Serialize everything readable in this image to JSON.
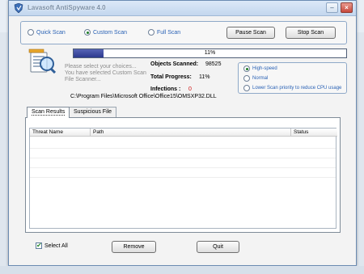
{
  "window": {
    "title": "Lavasoft AntiSpyware 4.0"
  },
  "scan_modes": {
    "options": [
      {
        "label": "Quick Scan",
        "checked": false
      },
      {
        "label": "Custom Scan",
        "checked": true
      },
      {
        "label": "Full Scan",
        "checked": false
      }
    ],
    "pause_label": "Pause Scan",
    "stop_label": "Stop Scan"
  },
  "progress": {
    "percent": 11,
    "text": "11%"
  },
  "hint": {
    "line1": "Please select your choices...",
    "line2": "You have selected Custom Scan",
    "line3": "File Scanner..."
  },
  "stats": {
    "objects_label": "Objects Scanned:",
    "objects_value": "98525",
    "total_label": "Total Progress:",
    "total_value": "11%",
    "infections_label": "Infections :",
    "infections_value": "0"
  },
  "speed": {
    "options": [
      {
        "label": "High-speed",
        "checked": true
      },
      {
        "label": "Normal",
        "checked": false
      },
      {
        "label": "Lower Scan priority to reduce CPU usage",
        "checked": false
      }
    ]
  },
  "current_path": "C:\\Program Files\\Microsoft Office\\Office15\\OMSXP32.DLL",
  "tabs": [
    {
      "label": "Scan Results",
      "active": true
    },
    {
      "label": "Suspicious File",
      "active": false
    }
  ],
  "table": {
    "columns": [
      "Threat Name",
      "Path",
      "Status"
    ],
    "rows": []
  },
  "footer": {
    "select_all_label": "Select All",
    "select_all_checked": true,
    "remove_label": "Remove",
    "quit_label": "Quit"
  },
  "colors": {
    "accent_blue": "#2a62b5",
    "progress_fill": "#2d3a8f",
    "infection_red": "#d01010",
    "check_green": "#2a8a2f"
  }
}
